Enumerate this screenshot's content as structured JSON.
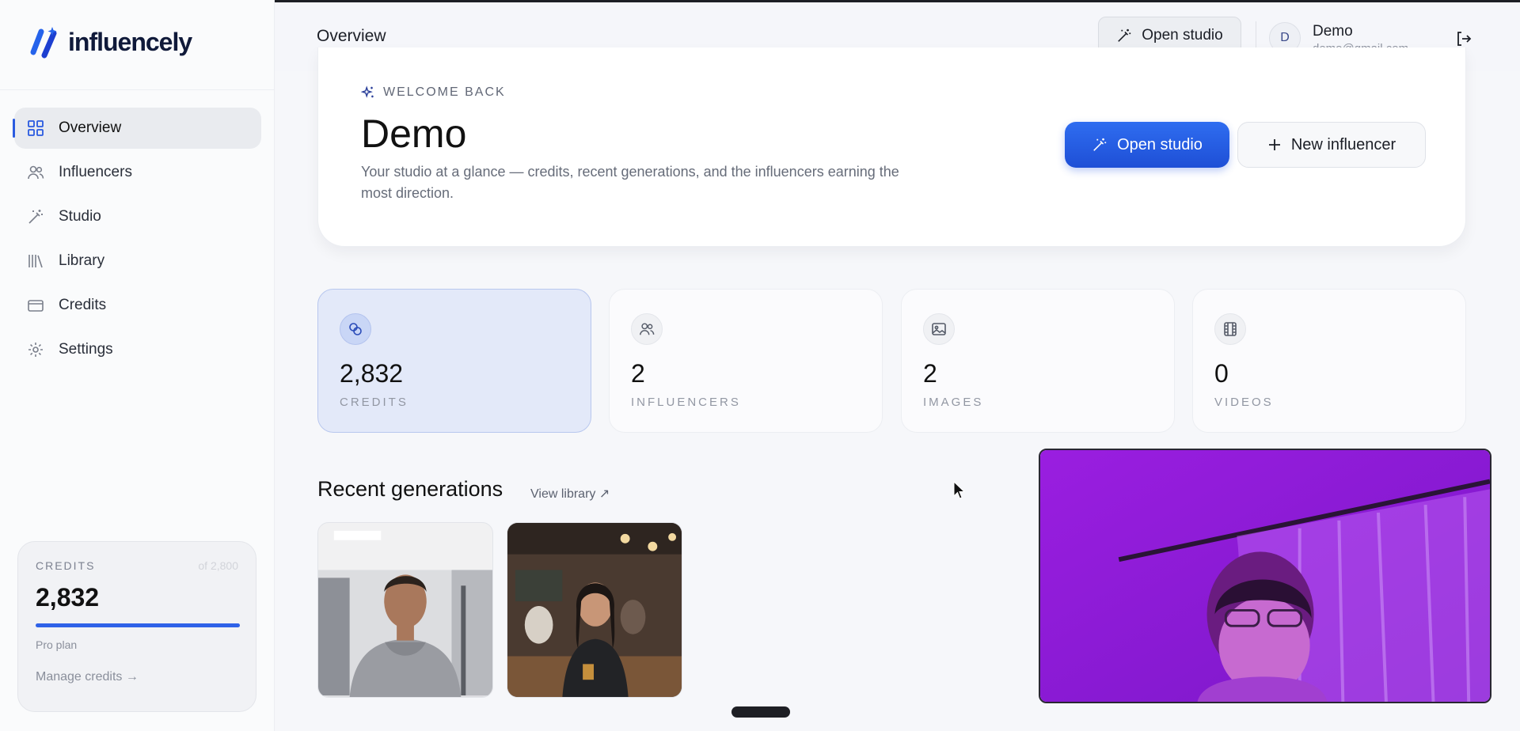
{
  "app": {
    "name": "influencely"
  },
  "sidebar": {
    "items": [
      {
        "label": "Overview",
        "icon": "grid-icon",
        "active": true
      },
      {
        "label": "Influencers",
        "icon": "users-icon"
      },
      {
        "label": "Studio",
        "icon": "magic-wand-icon"
      },
      {
        "label": "Library",
        "icon": "library-icon"
      },
      {
        "label": "Credits",
        "icon": "credit-card-icon"
      },
      {
        "label": "Settings",
        "icon": "gear-icon"
      }
    ],
    "credits_card": {
      "label": "CREDITS",
      "of_total": "of 2,800",
      "value": "2,832",
      "fill_fraction": 1.0,
      "plan": "Pro plan",
      "manage": "Manage credits →"
    }
  },
  "header": {
    "title": "Overview",
    "open_studio": "Open studio",
    "avatar_initial": "D",
    "user_name": "Demo",
    "user_email": "demo@gmail.com"
  },
  "hero": {
    "eyebrow": "WELCOME BACK",
    "name": "Demo",
    "description": "Your studio at a glance — credits, recent generations, and the influencers earning the most direction.",
    "primary_button": "Open studio",
    "secondary_button": "New influencer"
  },
  "stats": [
    {
      "value": "2,832",
      "label": "CREDITS",
      "icon": "coins-icon",
      "highlight": true
    },
    {
      "value": "2",
      "label": "INFLUENCERS",
      "icon": "users-icon"
    },
    {
      "value": "2",
      "label": "IMAGES",
      "icon": "image-icon"
    },
    {
      "value": "0",
      "label": "VIDEOS",
      "icon": "film-icon"
    }
  ],
  "recent": {
    "title": "Recent generations",
    "view_library": "View library ↗"
  },
  "colors": {
    "accent": "#2f62e8",
    "highlight_card": "#e3e9f9",
    "webcam_tint": "#9a1ee0"
  }
}
